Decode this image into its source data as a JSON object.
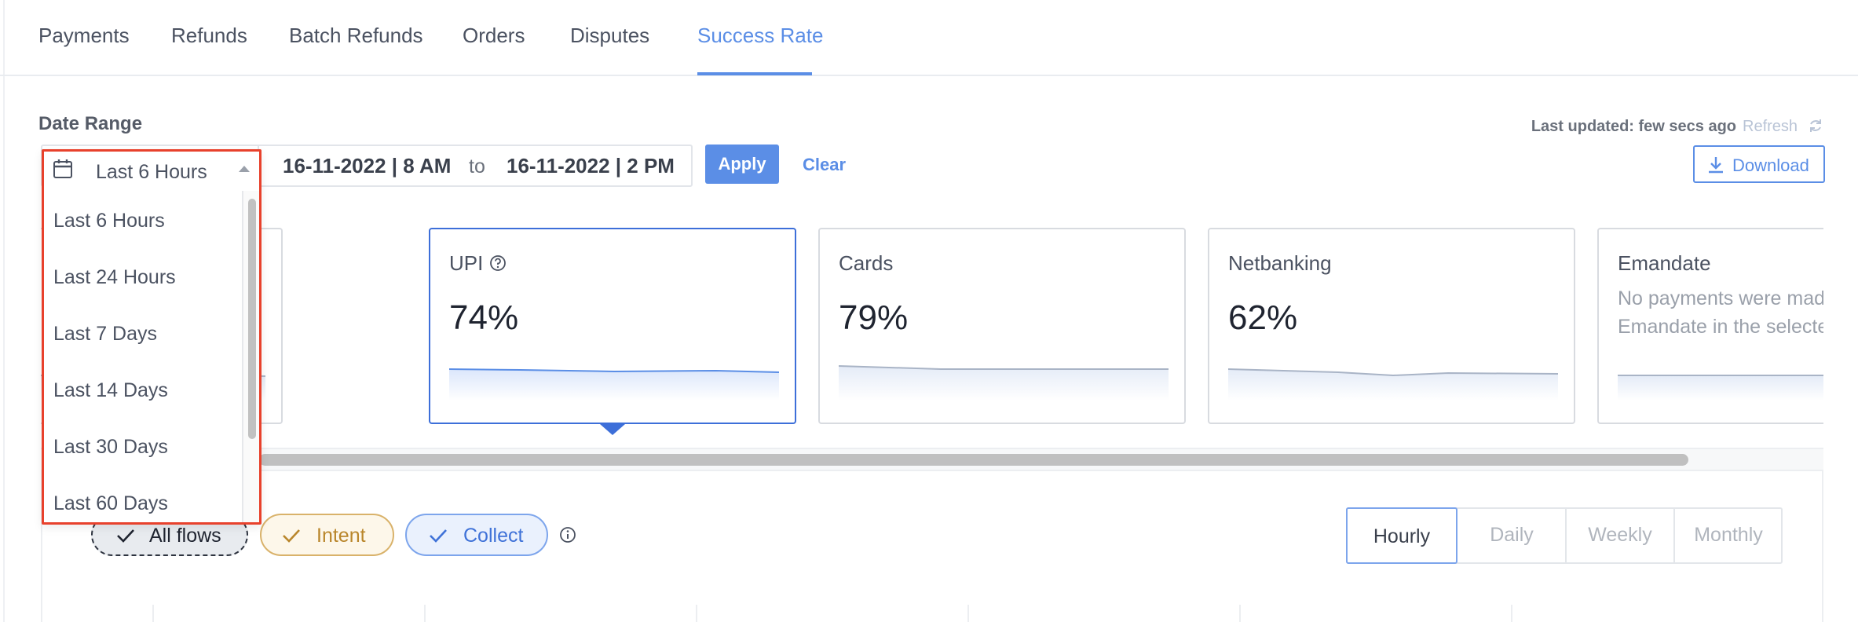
{
  "tabs": [
    {
      "label": "Payments",
      "active": false
    },
    {
      "label": "Refunds",
      "active": false
    },
    {
      "label": "Batch Refunds",
      "active": false
    },
    {
      "label": "Orders",
      "active": false
    },
    {
      "label": "Disputes",
      "active": false
    },
    {
      "label": "Success Rate",
      "active": true
    }
  ],
  "date_range": {
    "label": "Date Range",
    "preset_selected": "Last 6 Hours",
    "from": "16-11-2022 | 8 AM",
    "to_word": "to",
    "to": "16-11-2022 | 2 PM",
    "apply_label": "Apply",
    "clear_label": "Clear",
    "presets": [
      "Last 6 Hours",
      "Last 24 Hours",
      "Last 7 Days",
      "Last 14 Days",
      "Last 30 Days",
      "Last 60 Days"
    ]
  },
  "status": {
    "last_updated": "Last updated: few secs ago",
    "refresh_label": "Refresh",
    "download_label": "Download"
  },
  "cards": [
    {
      "title": "",
      "value": "",
      "message": "",
      "selected": false
    },
    {
      "title": "UPI",
      "value": "74%",
      "message": "",
      "selected": true,
      "has_help": true
    },
    {
      "title": "Cards",
      "value": "79%",
      "message": "",
      "selected": false
    },
    {
      "title": "Netbanking",
      "value": "62%",
      "message": "",
      "selected": false
    },
    {
      "title": "Emandate",
      "value": "",
      "message_line1": "No payments were made using",
      "message_line2": "Emandate in the selected time",
      "selected": false
    }
  ],
  "flows": {
    "all_label": "All flows",
    "intent_label": "Intent",
    "collect_label": "Collect"
  },
  "granularity": {
    "options": [
      "Hourly",
      "Daily",
      "Weekly",
      "Monthly"
    ],
    "selected": "Hourly"
  },
  "colors": {
    "accent": "#5b8ee6",
    "selected_card": "#3d6fd9",
    "dropdown_outline": "#e8412c",
    "intent": "#b9862b",
    "collect": "#3f72d8"
  },
  "icons": [
    "calendar-icon",
    "caret-up-icon",
    "refresh-icon",
    "download-icon",
    "help-icon",
    "check-icon",
    "info-icon"
  ]
}
